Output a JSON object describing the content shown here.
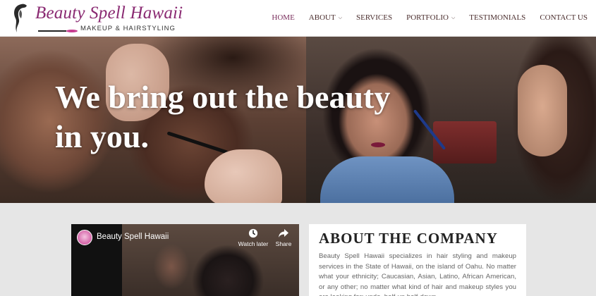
{
  "brand": {
    "name": "Beauty Spell Hawaii",
    "tagline": "MAKEUP & HAIRSTYLING",
    "accent": "#8a2a72"
  },
  "nav": {
    "items": [
      {
        "label": "HOME",
        "active": true,
        "has_dropdown": false
      },
      {
        "label": "ABOUT",
        "active": false,
        "has_dropdown": true
      },
      {
        "label": "SERVICES",
        "active": false,
        "has_dropdown": false
      },
      {
        "label": "PORTFOLIO",
        "active": false,
        "has_dropdown": true
      },
      {
        "label": "TESTIMONIALS",
        "active": false,
        "has_dropdown": false
      },
      {
        "label": "CONTACT US",
        "active": false,
        "has_dropdown": false
      }
    ],
    "active_color": "#7a2e5c"
  },
  "hero": {
    "line1": "We bring out the beauty",
    "line2": "in you."
  },
  "video": {
    "title": "Beauty Spell Hawaii",
    "watch_later": "Watch later",
    "share": "Share"
  },
  "about": {
    "title": "ABOUT THE COMPANY",
    "text": "Beauty Spell Hawaii specializes in hair styling and makeup services in the State of Hawaii, on the island of Oahu.  No matter what your ethnicity; Caucasian, Asian, Latino, African American, or any other; no matter what kind of hair and makeup styles you are looking for; updo, half-up half-down,"
  },
  "icons": [
    "logo-silhouette-icon",
    "caret-down-icon",
    "clock-icon",
    "share-icon"
  ]
}
